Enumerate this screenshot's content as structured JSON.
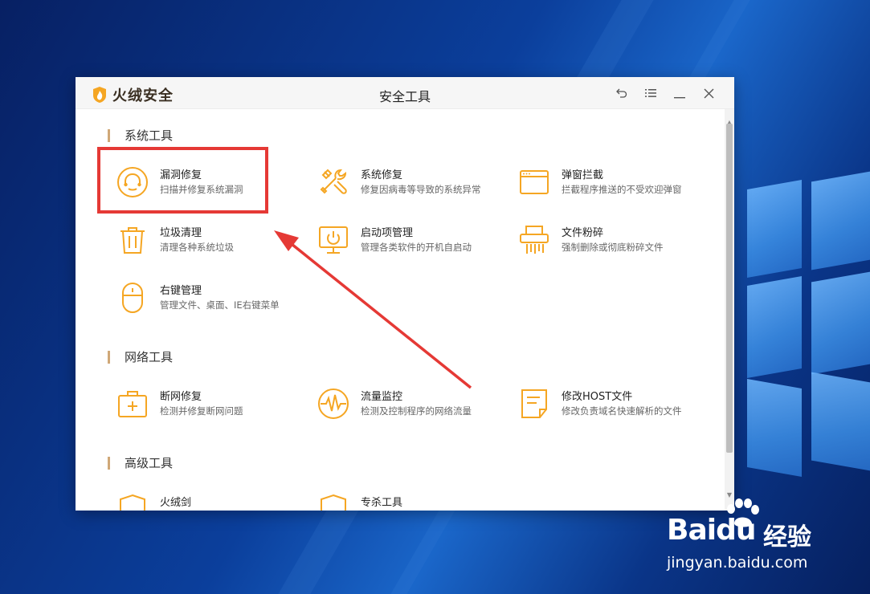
{
  "app": {
    "brand": "火绒安全",
    "window_title": "安全工具"
  },
  "title_controls": [
    {
      "name": "back-icon"
    },
    {
      "name": "menu-icon"
    },
    {
      "name": "minimize-icon"
    },
    {
      "name": "close-icon"
    }
  ],
  "sections": {
    "system": {
      "label": "系统工具",
      "tools": [
        {
          "name": "漏洞修复",
          "desc": "扫描并修复系统漏洞",
          "icon": "headset-icon"
        },
        {
          "name": "系统修复",
          "desc": "修复因病毒等导致的系统异常",
          "icon": "tools-icon"
        },
        {
          "name": "弹窗拦截",
          "desc": "拦截程序推送的不受欢迎弹窗",
          "icon": "popup-window-icon"
        },
        {
          "name": "垃圾清理",
          "desc": "清理各种系统垃圾",
          "icon": "trash-icon"
        },
        {
          "name": "启动项管理",
          "desc": "管理各类软件的开机自启动",
          "icon": "monitor-icon"
        },
        {
          "name": "文件粉碎",
          "desc": "强制删除或彻底粉碎文件",
          "icon": "shredder-icon"
        },
        {
          "name": "右键管理",
          "desc": "管理文件、桌面、IE右键菜单",
          "icon": "mouse-icon"
        }
      ]
    },
    "network": {
      "label": "网络工具",
      "tools": [
        {
          "name": "断网修复",
          "desc": "检测并修复断网问题",
          "icon": "first-aid-icon"
        },
        {
          "name": "流量监控",
          "desc": "检测及控制程序的网络流量",
          "icon": "pulse-icon"
        },
        {
          "name": "修改HOST文件",
          "desc": "修改负责域名快速解析的文件",
          "icon": "document-icon"
        }
      ]
    },
    "advanced": {
      "label": "高级工具",
      "tools": [
        {
          "name": "火绒剑",
          "icon": "shield-icon"
        },
        {
          "name": "专杀工具",
          "icon": "shield-icon"
        }
      ]
    }
  },
  "watermark": {
    "brand": "Baidu",
    "cn": "经验",
    "url": "jingyan.baidu.com"
  },
  "colors": {
    "accent": "#f5a623",
    "highlight": "#e53935",
    "section_bar": "#d0a878"
  }
}
